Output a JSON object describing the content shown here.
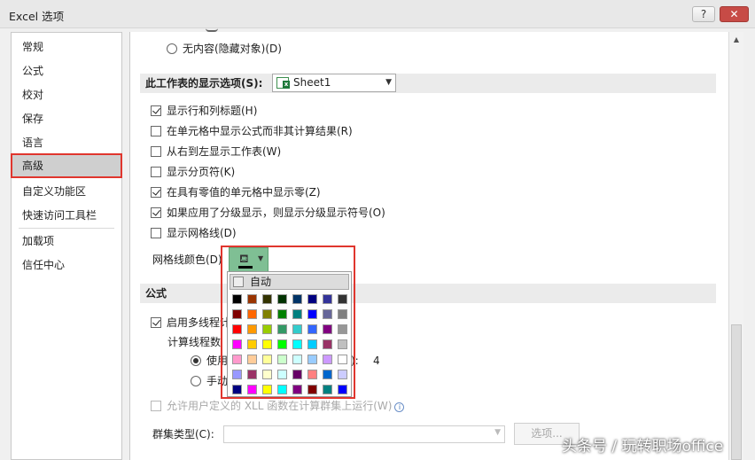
{
  "window": {
    "title": "Excel 选项",
    "help_label": "?",
    "close_label": "✕"
  },
  "nav": {
    "items": [
      {
        "label": "常规"
      },
      {
        "label": "公式"
      },
      {
        "label": "校对"
      },
      {
        "label": "保存"
      },
      {
        "label": "语言"
      },
      {
        "label": "高级",
        "selected": true
      },
      {
        "label": "自定义功能区"
      },
      {
        "label": "快速访问工具栏"
      },
      {
        "label": "加载项"
      },
      {
        "label": "信任中心"
      }
    ]
  },
  "content": {
    "hidden_objects_option": "无内容(隐藏对象)(D)",
    "sheet_section": {
      "label": "此工作表的显示选项(S):",
      "sheet_value": "Sheet1",
      "options": [
        {
          "label": "显示行和列标题(H)",
          "checked": true
        },
        {
          "label": "在单元格中显示公式而非其计算结果(R)",
          "checked": false
        },
        {
          "label": "从右到左显示工作表(W)",
          "checked": false
        },
        {
          "label": "显示分页符(K)",
          "checked": false
        },
        {
          "label": "在具有零值的单元格中显示零(Z)",
          "checked": true
        },
        {
          "label": "如果应用了分级显示，则显示分级显示符号(O)",
          "checked": true
        },
        {
          "label": "显示网格线(D)",
          "checked": false
        }
      ],
      "gridline_color_label": "网格线颜色(D)"
    },
    "palette": {
      "auto_label": "自动",
      "colors": [
        [
          "#000000",
          "#993300",
          "#333300",
          "#003300",
          "#003366",
          "#000080",
          "#333399",
          "#333333"
        ],
        [
          "#800000",
          "#FF6600",
          "#808000",
          "#008000",
          "#008080",
          "#0000FF",
          "#666699",
          "#808080"
        ],
        [
          "#FF0000",
          "#FF9900",
          "#99CC00",
          "#339966",
          "#33CCCC",
          "#3366FF",
          "#800080",
          "#969696"
        ],
        [
          "#FF00FF",
          "#FFCC00",
          "#FFFF00",
          "#00FF00",
          "#00FFFF",
          "#00CCFF",
          "#993366",
          "#C0C0C0"
        ],
        [
          "#FF99CC",
          "#FFCC99",
          "#FFFF99",
          "#CCFFCC",
          "#CCFFFF",
          "#99CCFF",
          "#CC99FF",
          "#FFFFFF"
        ],
        [
          "#9999FF",
          "#993366",
          "#FFFFCC",
          "#CCFFFF",
          "#660066",
          "#FF8080",
          "#0066CC",
          "#CCCCFF"
        ],
        [
          "#000080",
          "#FF00FF",
          "#FFFF00",
          "#00FFFF",
          "#800080",
          "#800000",
          "#008080",
          "#0000FF"
        ]
      ]
    },
    "formula_section": {
      "label": "公式",
      "multithread_label": "启用多线程计",
      "thread_count_label": "计算线程数",
      "use_label": "使用",
      "use_suffix": "):",
      "thread_count_value": "4",
      "manual_label": "手动",
      "allow_xll_label": "允许用户定义的 XLL 函数在计算群集上运行(W)",
      "cluster_type_label": "群集类型(C):",
      "options_button": "选项..."
    }
  },
  "watermark": "头条号 / 玩转职场office"
}
